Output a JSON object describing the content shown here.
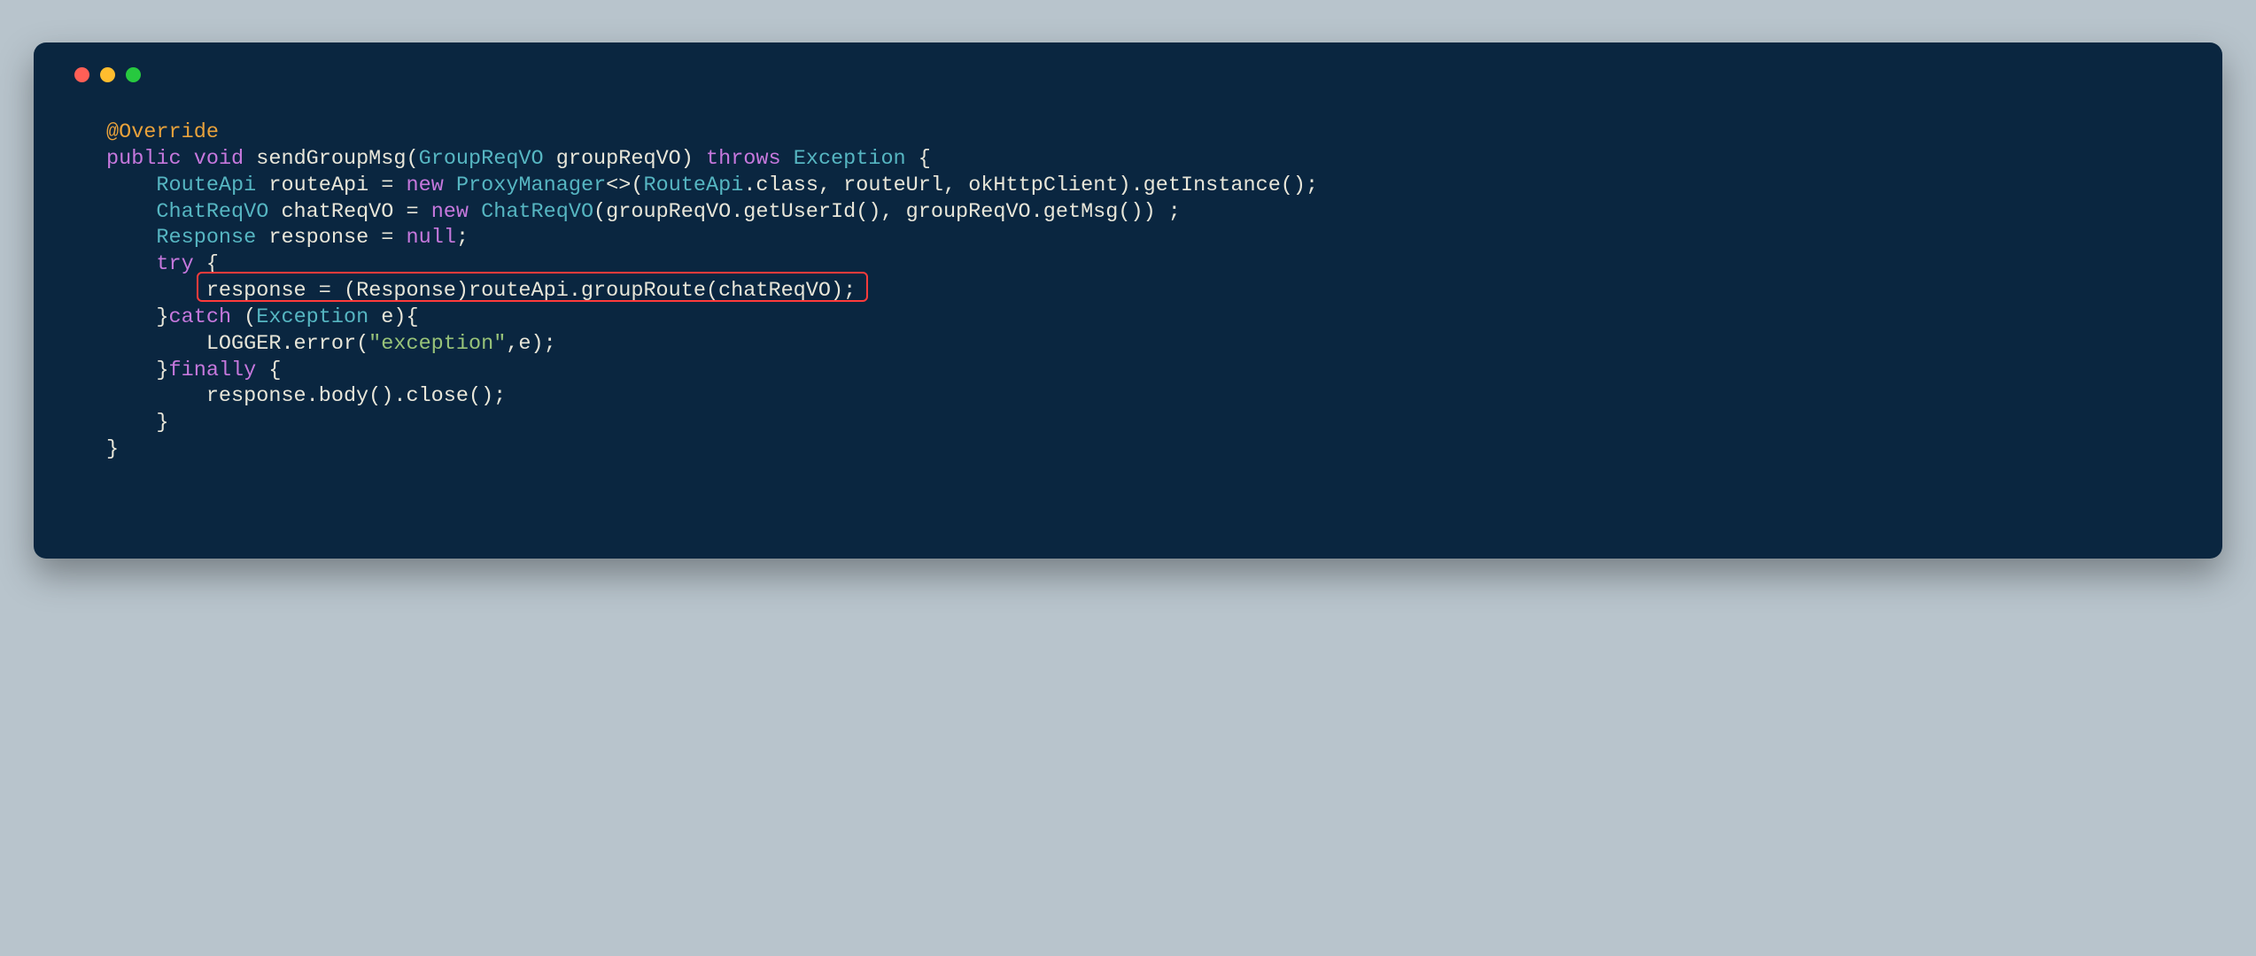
{
  "window": {
    "traffic": {
      "red": "close",
      "yellow": "minimize",
      "green": "zoom"
    }
  },
  "code": {
    "annotation": "@Override",
    "sig": {
      "kw_public": "public",
      "kw_void": "void",
      "method": "sendGroupMsg",
      "param_type": "GroupReqVO",
      "param_name": "groupReqVO",
      "kw_throws": "throws",
      "exc": "Exception"
    },
    "l1": {
      "type": "RouteApi",
      "var": "routeApi",
      "eq": "=",
      "kw_new": "new",
      "ctor": "ProxyManager",
      "angle": "<>",
      "arg1": "RouteApi",
      "arg1_class": ".class",
      "arg2": "routeUrl",
      "arg3": "okHttpClient",
      "tail": ".getInstance();"
    },
    "l2": {
      "type": "ChatReqVO",
      "var": "chatReqVO",
      "eq": "=",
      "kw_new": "new",
      "ctor": "ChatReqVO",
      "arg1a": "groupReqVO",
      "arg1b": ".getUserId()",
      "arg2a": "groupReqVO",
      "arg2b": ".getMsg()",
      "tail": " ;"
    },
    "l3": {
      "type": "Response",
      "var": "response",
      "eq": "=",
      "null": "null",
      "semi": ";"
    },
    "try": "try",
    "l5": {
      "lhs": "response",
      "eq": "=",
      "cast": "(Response)",
      "call": "routeApi.groupRoute(chatReqVO);"
    },
    "catch": {
      "kw": "catch",
      "type": "Exception",
      "var": "e"
    },
    "l7": {
      "logger": "LOGGER",
      "call": ".error(",
      "str": "\"exception\"",
      "rest": ",e);"
    },
    "finally": "finally",
    "l9": "response.body().close();"
  },
  "highlight": {
    "line_index": 5,
    "content": "response = (Response)routeApi.groupRoute(chatReqVO);"
  }
}
